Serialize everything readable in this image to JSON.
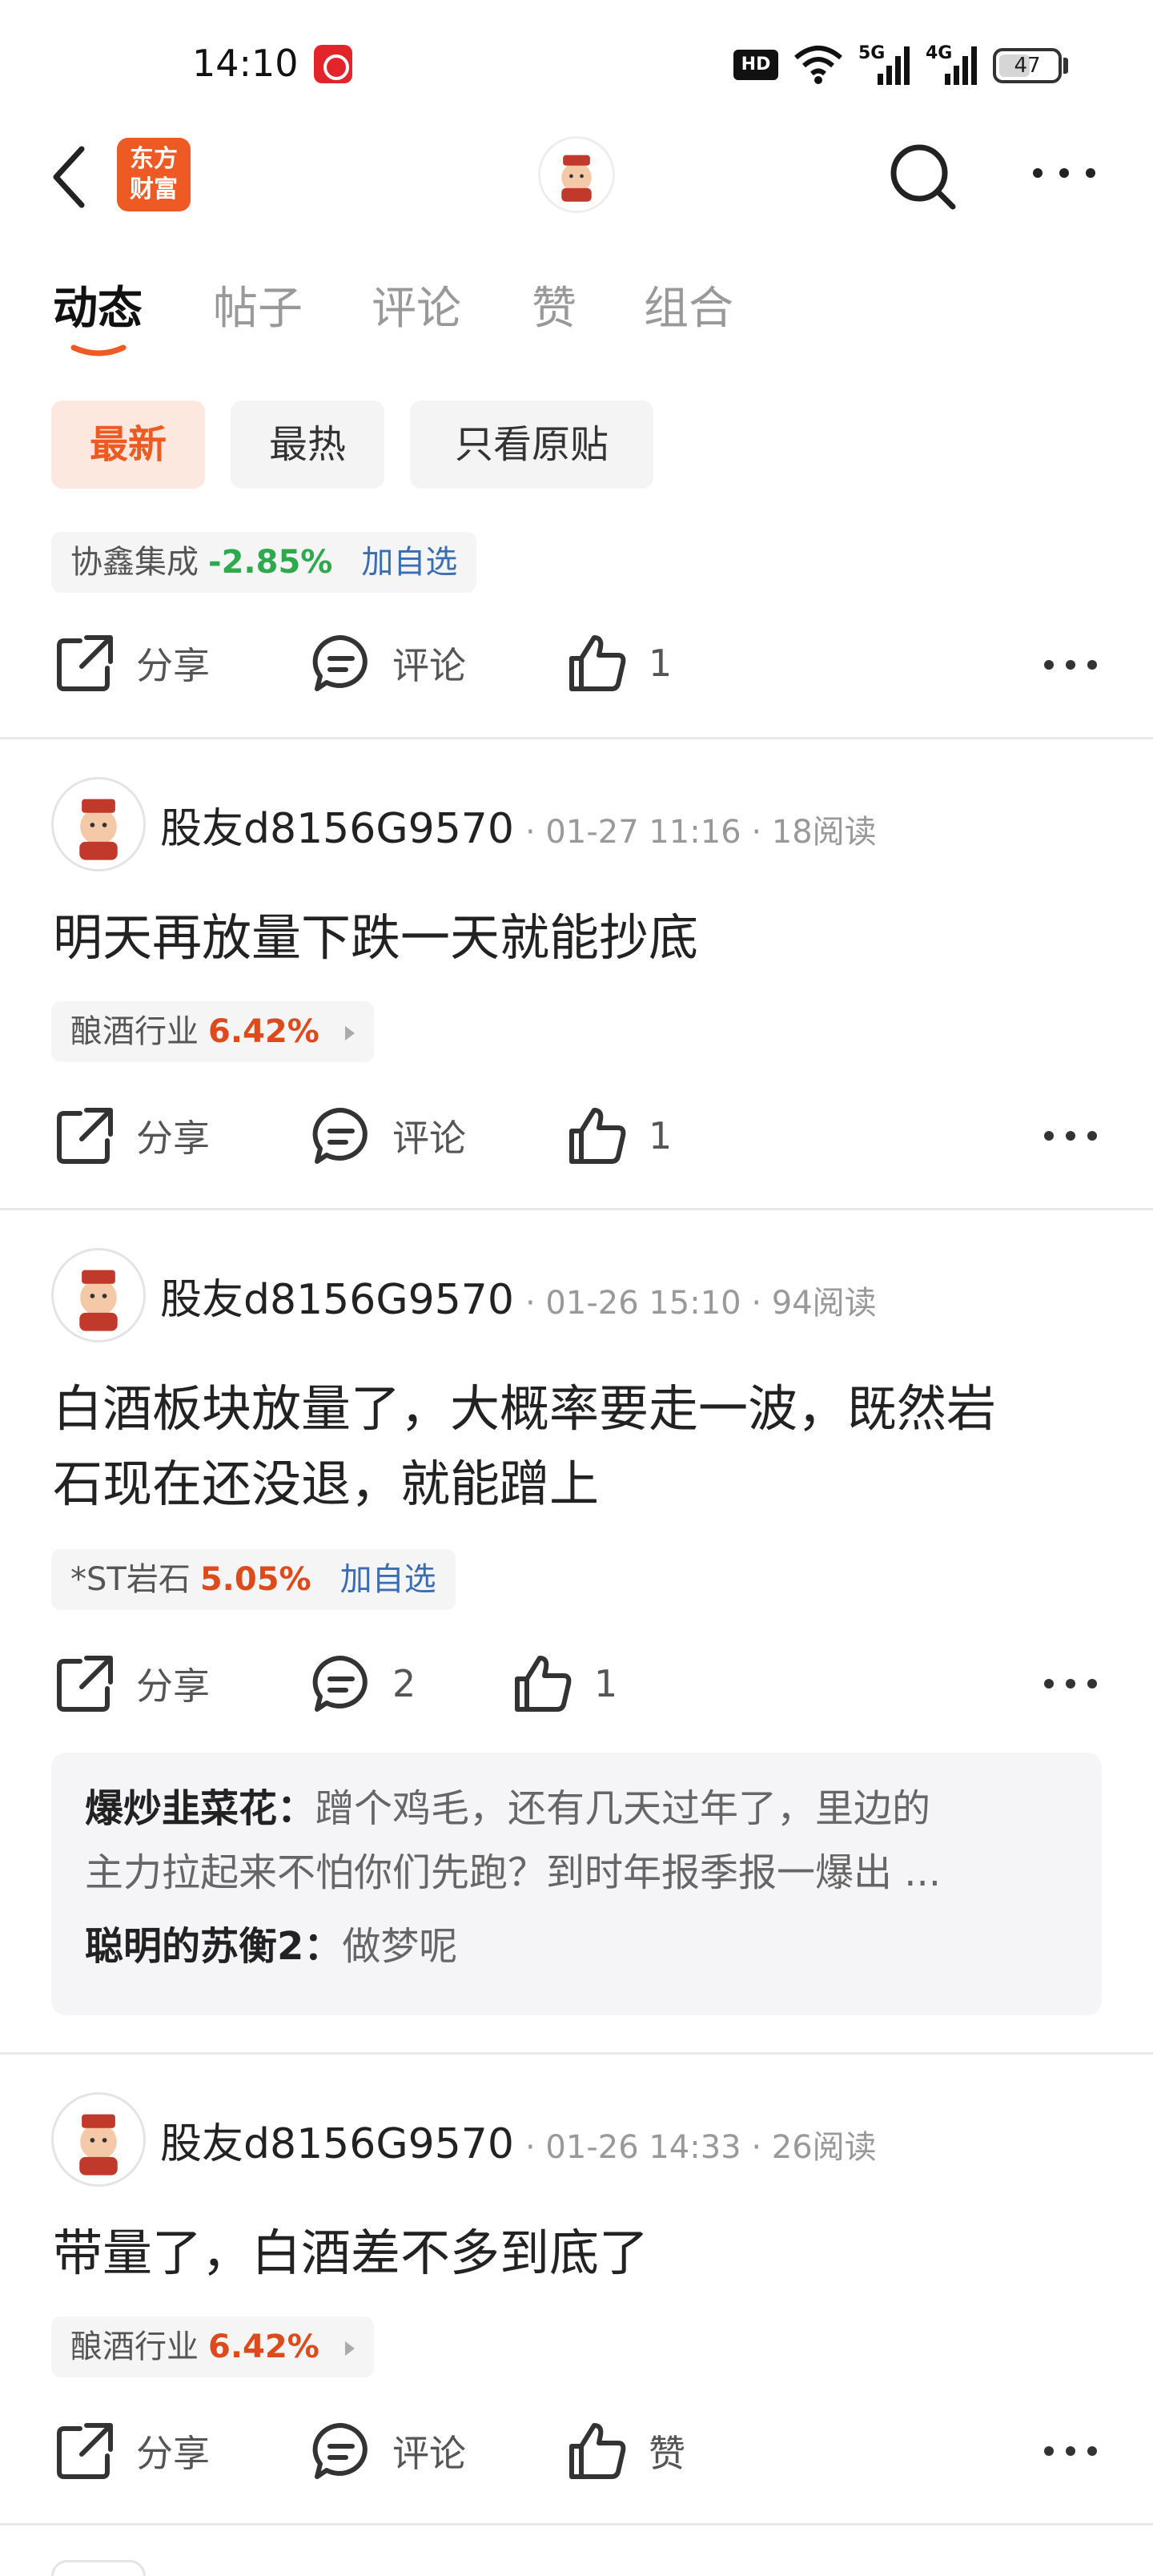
{
  "status_bar": {
    "time": "14:10",
    "hd": "HD",
    "net1": "5G",
    "net2": "4G",
    "battery": "47"
  },
  "nav": {
    "logo_line1": "东方",
    "logo_line2": "财富"
  },
  "tabs": [
    "动态",
    "帖子",
    "评论",
    "赞",
    "组合"
  ],
  "filters": [
    "最新",
    "最热",
    "只看原贴"
  ],
  "first_post": {
    "stock": {
      "name": "协鑫集成",
      "pct": "-2.85%",
      "add": "加自选"
    },
    "actions": {
      "share": "分享",
      "comment": "评论",
      "like": "1"
    }
  },
  "posts": [
    {
      "author": "股友d8156G9570",
      "meta": "· 01-27 11:16 · 18阅读",
      "text": "明天再放量下跌一天就能抄底",
      "stock": {
        "name": "酿酒行业",
        "pct": "6.42%"
      },
      "actions": {
        "share": "分享",
        "comment": "评论",
        "like": "1"
      }
    },
    {
      "author": "股友d8156G9570",
      "meta": "· 01-26 15:10 · 94阅读",
      "text_line1": "白酒板块放量了，大概率要走一波，既然岩",
      "text_line2": "石现在还没退，就能蹭上",
      "stock": {
        "name": "*ST岩石",
        "pct": "5.05%",
        "add": "加自选"
      },
      "actions": {
        "share": "分享",
        "comment": "2",
        "like": "1"
      },
      "comments": [
        {
          "user": "爆炒韭菜花：",
          "text_line1": "蹭个鸡毛，还有几天过年了，里边的",
          "text_line2": "主力拉起来不怕你们先跑？到时年报季报一爆出 ..."
        },
        {
          "user": "聪明的苏衡2：",
          "text": "做梦呢"
        }
      ]
    },
    {
      "author": "股友d8156G9570",
      "meta": "· 01-26 14:33 · 26阅读",
      "text": "带量了，白酒差不多到底了",
      "stock": {
        "name": "酿酒行业",
        "pct": "6.42%"
      },
      "actions": {
        "share": "分享",
        "comment": "评论",
        "like": "赞"
      }
    }
  ]
}
